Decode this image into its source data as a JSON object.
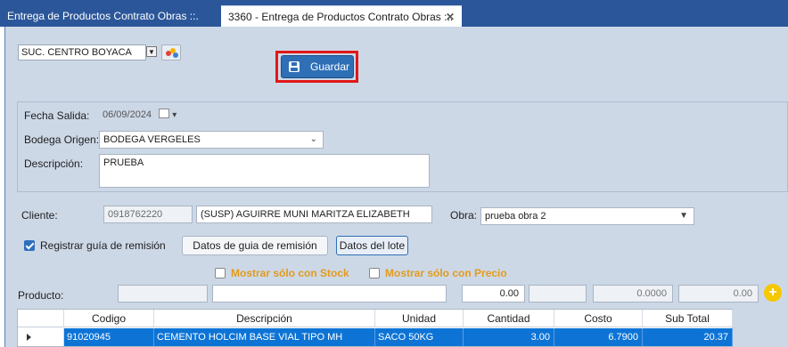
{
  "tabs": [
    {
      "label": "Entrega de Productos Contrato Obras  ::."
    },
    {
      "label": "3360 - Entrega de Productos Contrato Obras  ::."
    }
  ],
  "branch": {
    "selected": "SUC. CENTRO BOYACA"
  },
  "toolbar": {
    "save_label": "Guardar"
  },
  "form": {
    "fecha_label": "Fecha Salida:",
    "fecha_value": "06/09/2024",
    "bodega_label": "Bodega Origen:",
    "bodega_value": "BODEGA VERGELES",
    "descripcion_label": "Descripción:",
    "descripcion_value": "PRUEBA"
  },
  "client": {
    "label": "Cliente:",
    "id": "0918762220",
    "name": "(SUSP) AGUIRRE MUNI MARITZA ELIZABETH",
    "obra_label": "Obra:",
    "obra_value": "prueba obra 2"
  },
  "options": {
    "registrar_label": "Registrar guía de remisión",
    "registrar_checked": true,
    "datos_guia_label": "Datos de guia de remisión",
    "datos_lote_label": "Datos del lote",
    "stock_label": "Mostrar sólo con Stock",
    "precio_label": "Mostrar sólo con Precio"
  },
  "producto": {
    "label": "Producto:",
    "cantidad": "0.00",
    "costo": "0.0000",
    "subtotal": "0.00"
  },
  "table": {
    "headers": [
      "Codigo",
      "Descripción",
      "Unidad",
      "Cantidad",
      "Costo",
      "Sub Total"
    ],
    "rows": [
      {
        "codigo": "91020945",
        "descripcion": "CEMENTO HOLCIM BASE VIAL TIPO MH",
        "unidad": "SACO 50KG",
        "cantidad": "3.00",
        "costo": "6.7900",
        "subtotal": "20.37"
      }
    ]
  },
  "colors": {
    "accent": "#2b579a",
    "selection": "#0d74d6",
    "highlight": "#e01818",
    "warning": "#e39b1a"
  }
}
